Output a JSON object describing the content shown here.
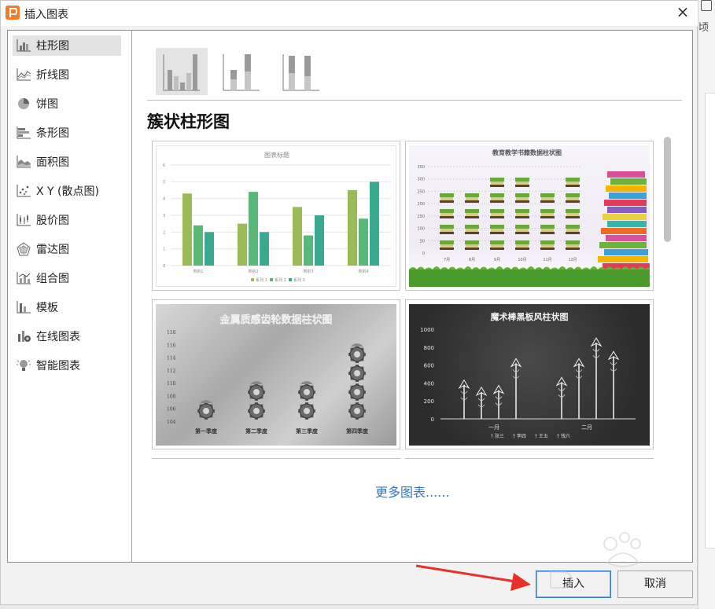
{
  "dialog": {
    "title": "插入图表",
    "close_glyph": "×",
    "right_edge_fragment": "顷"
  },
  "sidebar": {
    "items": [
      {
        "label": "柱形图",
        "icon": "column-chart-icon"
      },
      {
        "label": "折线图",
        "icon": "line-chart-icon"
      },
      {
        "label": "饼图",
        "icon": "pie-chart-icon"
      },
      {
        "label": "条形图",
        "icon": "bar-chart-icon"
      },
      {
        "label": "面积图",
        "icon": "area-chart-icon"
      },
      {
        "label": "X Y (散点图)",
        "icon": "scatter-chart-icon"
      },
      {
        "label": "股价图",
        "icon": "stock-chart-icon"
      },
      {
        "label": "雷达图",
        "icon": "radar-chart-icon"
      },
      {
        "label": "组合图",
        "icon": "combo-chart-icon"
      },
      {
        "label": "模板",
        "icon": "template-icon"
      },
      {
        "label": "在线图表",
        "icon": "online-chart-icon"
      },
      {
        "label": "智能图表",
        "icon": "smart-chart-icon"
      }
    ],
    "selected_index": 0
  },
  "subtypes": [
    {
      "name": "clustered-column",
      "selected": true
    },
    {
      "name": "stacked-column",
      "selected": false
    },
    {
      "name": "percent-stacked-column",
      "selected": false
    }
  ],
  "section_title": "簇状柱形图",
  "thumbnails": {
    "t1": {
      "title": "图表标题",
      "y_ticks": [
        "6",
        "5",
        "4",
        "3",
        "2",
        "1",
        "0"
      ],
      "categories": [
        "类别1",
        "类别2",
        "类别3",
        "类别4"
      ],
      "series": [
        {
          "name": "系列 1",
          "values": [
            4.3,
            2.5,
            3.5,
            4.5
          ],
          "color": "#9bbb59"
        },
        {
          "name": "系列 2",
          "values": [
            2.4,
            4.4,
            1.8,
            2.8
          ],
          "color": "#5bb679"
        },
        {
          "name": "系列 3",
          "values": [
            2,
            2,
            3,
            5
          ],
          "color": "#3aa98f"
        }
      ],
      "ymax": 6
    },
    "t2": {
      "title": "教育教学书籍数据柱状图",
      "y_ticks": [
        "350",
        "300",
        "250",
        "200",
        "150",
        "100",
        "50",
        "0"
      ],
      "categories": [
        "7月",
        "8月",
        "9月",
        "10月",
        "11月",
        "12月"
      ]
    },
    "t3": {
      "title": "金属质感齿轮数据柱状图",
      "y_ticks": [
        "118",
        "116",
        "114",
        "112",
        "110",
        "108",
        "106",
        "104"
      ],
      "categories": [
        "第一季度",
        "第二季度",
        "第三季度",
        "第四季度"
      ]
    },
    "t4": {
      "title": "魔术棒黑板风柱状图",
      "y_ticks": [
        "1000",
        "800",
        "600",
        "400",
        "200",
        "0"
      ],
      "categories": [
        "一月",
        "二月"
      ],
      "legend": [
        "张三",
        "李四",
        "王五",
        "钱六"
      ]
    }
  },
  "more_link": "更多图表......",
  "buttons": {
    "insert": "插入",
    "cancel": "取消"
  },
  "colors": {
    "accent_link": "#3a74c1",
    "primary_border": "#3c78d4",
    "arrow": "#e8302a"
  }
}
